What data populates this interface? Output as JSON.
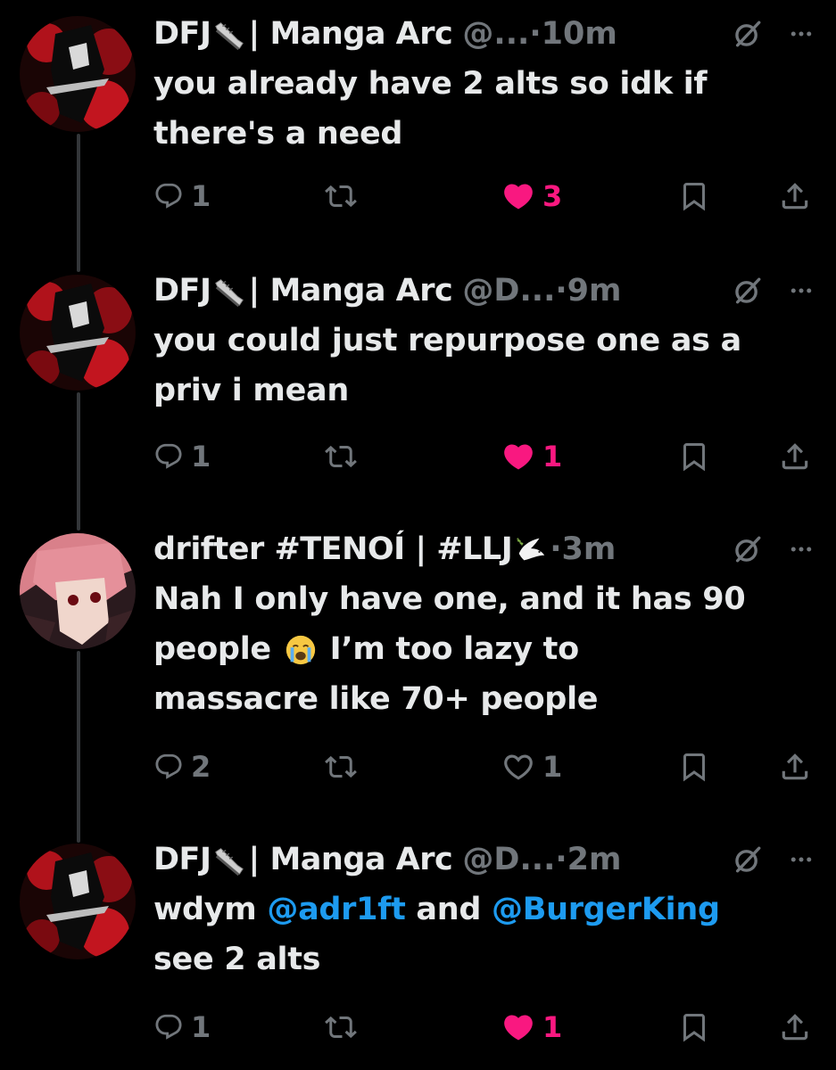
{
  "colors": {
    "background": "#000000",
    "text": "#e7e9ea",
    "muted": "#71767b",
    "like": "#f91880",
    "mention": "#1d9bf0"
  },
  "tweets": [
    {
      "name": "DFJ",
      "name_suffix": "| Manga Arc",
      "name_emoji": "shoe-emoji",
      "handle": "@...",
      "time": "10m",
      "text_lines": [
        "you already have 2 alts so idk if",
        "there's a need"
      ],
      "replies": "1",
      "likes": "3",
      "liked": true
    },
    {
      "name": "DFJ",
      "name_suffix": "| Manga Arc",
      "name_emoji": "shoe-emoji",
      "handle": "@D...",
      "time": "9m",
      "text_lines": [
        "you could just repurpose one as a",
        "priv i mean"
      ],
      "replies": "1",
      "likes": "1",
      "liked": true
    },
    {
      "name": "drifter #TENOÍ | #LLJ",
      "name_emoji": "dove-emoji",
      "time": "3m",
      "text_line1": "Nah I only have one, and it has 90",
      "text_line2a": "people",
      "text_line2b": "I’m too lazy to",
      "text_line3": "massacre like 70+ people",
      "text_emoji": "loudly-crying-face-emoji",
      "replies": "2",
      "likes": "1",
      "liked": false
    },
    {
      "name": "DFJ",
      "name_suffix": "| Manga Arc",
      "name_emoji": "shoe-emoji",
      "handle": "@D...",
      "time": "2m",
      "text_a": "wdym",
      "mention1": "@adr1ft",
      "text_b": "and",
      "mention2": "@BurgerKing",
      "text_line2": "see 2 alts",
      "replies": "1",
      "likes": "1",
      "liked": true
    }
  ]
}
